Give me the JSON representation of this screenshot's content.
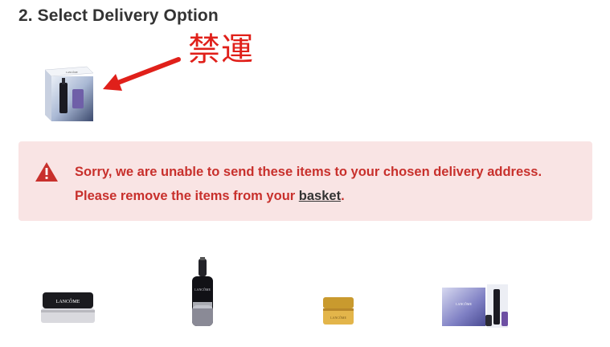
{
  "section": {
    "title": "2. Select Delivery Option"
  },
  "annotation": {
    "text": "禁運",
    "color": "#e0201a"
  },
  "alert": {
    "message_before": "Sorry, we are unable to send these items to your chosen delivery address. Please remove the items from your ",
    "link_label": "basket",
    "message_after": ".",
    "icon": "warning-triangle-icon",
    "background": "#f9e4e4",
    "text_color": "#c8302c"
  },
  "products": {
    "blocked_item": {
      "logo": "LANCÔME"
    },
    "items": [
      {
        "logo": "LANCÔME"
      },
      {
        "logo": "LANCÔME"
      },
      {
        "logo": "LANCÔME"
      },
      {
        "logo": "LANCÔME"
      }
    ]
  }
}
